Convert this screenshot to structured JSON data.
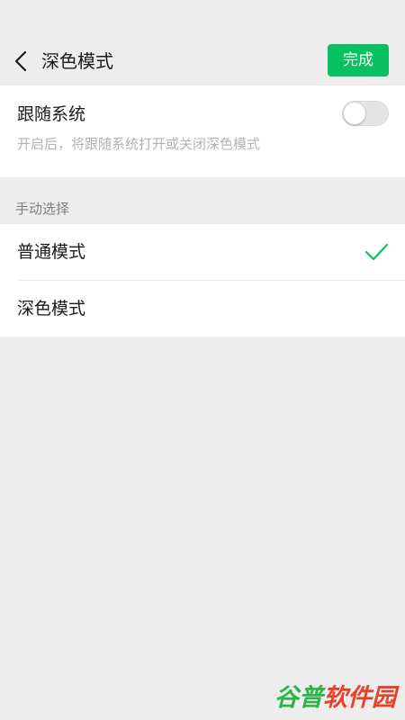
{
  "header": {
    "title": "深色模式",
    "done_label": "完成"
  },
  "follow_system": {
    "label": "跟随系统",
    "description": "开启后，将跟随系统打开或关闭深色模式",
    "enabled": false
  },
  "manual": {
    "section_label": "手动选择",
    "options": [
      {
        "label": "普通模式",
        "selected": true
      },
      {
        "label": "深色模式",
        "selected": false
      }
    ]
  },
  "watermark": {
    "part1": "谷普",
    "part2": "软件园"
  },
  "colors": {
    "accent": "#07c160",
    "background": "#ededed",
    "card": "#ffffff",
    "secondary_text": "#b2b2b2"
  },
  "icons": {
    "back": "chevron-left-icon",
    "check": "check-icon"
  }
}
